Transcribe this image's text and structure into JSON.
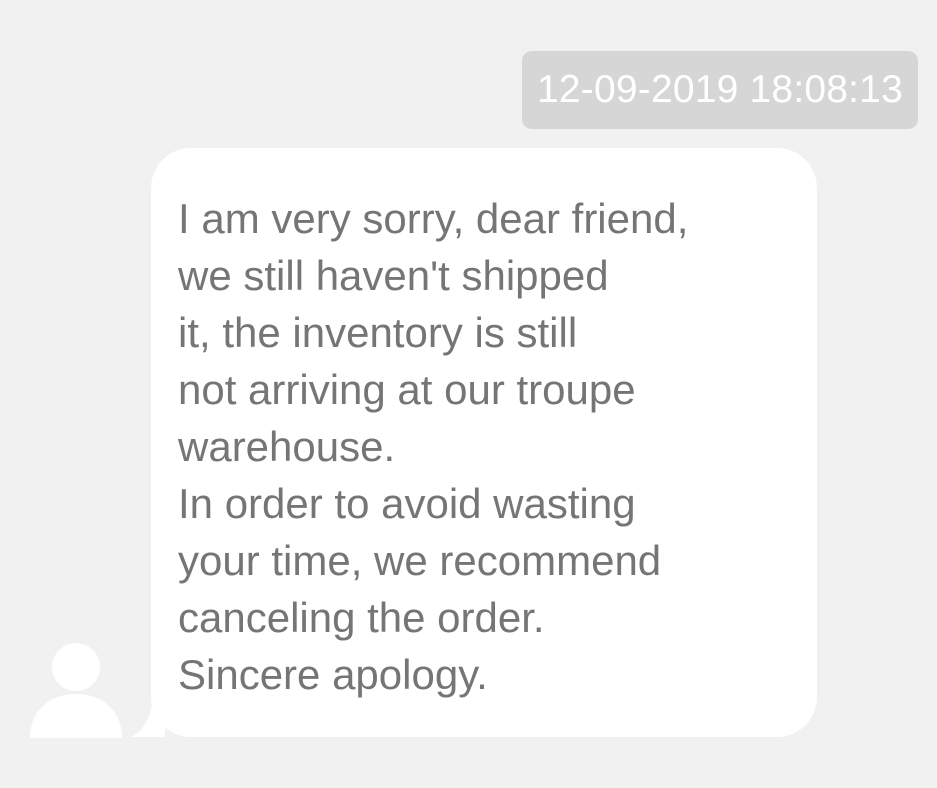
{
  "conversation": {
    "timestamp": "12-09-2019 18:08:13",
    "message": {
      "lines": [
        "I am very sorry, dear friend,",
        "we still haven't shipped",
        "it, the inventory is still",
        "not arriving at our troupe",
        "warehouse.",
        "In order to avoid wasting",
        "your time, we recommend",
        "canceling the order.",
        "Sincere apology."
      ]
    },
    "sender": {
      "avatar_icon": "user-silhouette-icon"
    }
  },
  "colors": {
    "background": "#f1f1f1",
    "timestamp_pill": "#d6d6d6",
    "timestamp_text": "#ffffff",
    "bubble": "#ffffff",
    "message_text": "#757575",
    "avatar": "#ffffff"
  }
}
